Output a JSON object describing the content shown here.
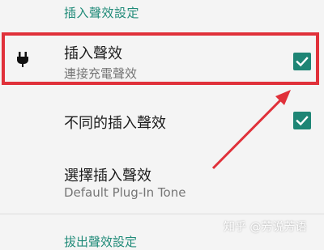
{
  "section_header": "插入聲效設定",
  "rows": [
    {
      "title": "插入聲效",
      "subtitle": "連接充電聲效",
      "checked": true,
      "icon": "plug-icon"
    },
    {
      "title": "不同的插入聲效",
      "checked": true
    },
    {
      "title": "選擇插入聲效",
      "subtitle": "Default Plug-In Tone"
    }
  ],
  "next_section_header": "拔出聲效設定",
  "watermark": "知乎 @芳说芳语",
  "colors": {
    "accent": "#1e8575",
    "highlight": "#e0313a",
    "background": "#f4f4f4"
  }
}
